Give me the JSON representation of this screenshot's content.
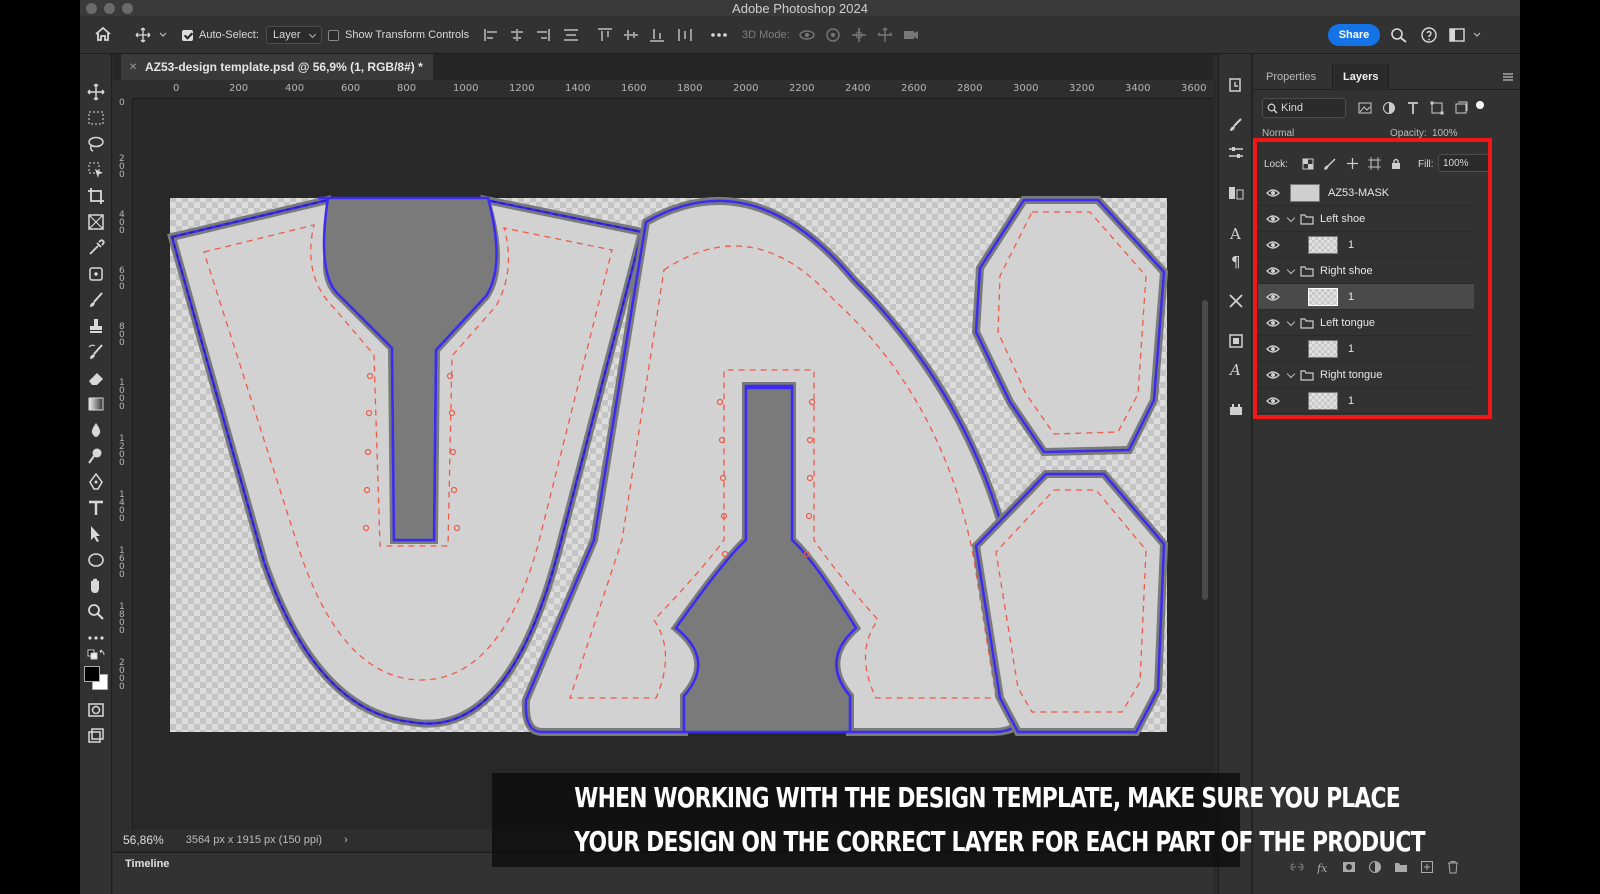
{
  "window": {
    "title": "Adobe Photoshop 2024"
  },
  "options_bar": {
    "auto_select_label": "Auto-Select:",
    "auto_select_checked": true,
    "auto_select_value": "Layer",
    "transform_controls_label": "Show Transform Controls",
    "transform_controls_checked": false,
    "mode_3d_label": "3D Mode:",
    "share_label": "Share",
    "share_color": "#1473e6"
  },
  "document": {
    "tab_title": "AZ53-design template.psd @ 56,9% (1, RGB/8#) *",
    "zoom": "56,86%",
    "dimensions": "3564 px x 1915 px (150 ppi)"
  },
  "ruler": {
    "h_ticks": [
      "0",
      "200",
      "400",
      "600",
      "800",
      "1000",
      "1200",
      "1400",
      "1600",
      "1800",
      "2000",
      "2200",
      "2400",
      "2600",
      "2800",
      "3000",
      "3200",
      "3400",
      "3600"
    ],
    "v_ticks": [
      "0",
      "200",
      "400",
      "600",
      "800",
      "1000",
      "1200",
      "1400",
      "1600",
      "1800",
      "2000"
    ]
  },
  "timeline": {
    "label": "Timeline"
  },
  "panels": {
    "tabs": [
      {
        "label": "Properties",
        "active": false
      },
      {
        "label": "Layers",
        "active": true
      }
    ],
    "filter_kind": "Kind",
    "blend_mode": "Normal",
    "opacity_label": "Opacity:",
    "opacity_value": "100%",
    "lock_label": "Lock:",
    "fill_label": "Fill:",
    "fill_value": "100%"
  },
  "layers": [
    {
      "name": "AZ53-MASK",
      "type": "layer",
      "indent": 0,
      "thumb": "mask"
    },
    {
      "name": "Left shoe",
      "type": "group",
      "indent": 0
    },
    {
      "name": "1",
      "type": "layer",
      "indent": 1,
      "thumb": "pattern"
    },
    {
      "name": "Right shoe",
      "type": "group",
      "indent": 0
    },
    {
      "name": "1",
      "type": "layer",
      "indent": 1,
      "thumb": "pattern",
      "selected": true
    },
    {
      "name": "Left tongue",
      "type": "group",
      "indent": 0
    },
    {
      "name": "1",
      "type": "layer",
      "indent": 1,
      "thumb": "pattern"
    },
    {
      "name": "Right tongue",
      "type": "group",
      "indent": 0
    },
    {
      "name": "1",
      "type": "layer",
      "indent": 1,
      "thumb": "pattern"
    }
  ],
  "caption": {
    "line1": "WHEN WORKING WITH THE DESIGN TEMPLATE, MAKE SURE YOU PLACE",
    "line2": "YOUR DESIGN ON THE CORRECT LAYER FOR EACH PART OF THE PRODUCT"
  },
  "colors": {
    "highlight_frame": "#f21717",
    "cut_line": "#3b2cf5",
    "safe_line": "#ef5a4a",
    "pattern_fill": "#d2d2d2",
    "slot_fill": "#7a7a7a"
  }
}
